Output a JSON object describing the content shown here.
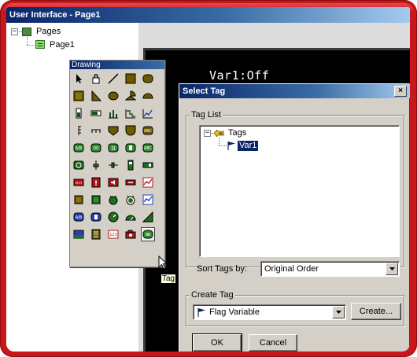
{
  "window": {
    "title": "User Interface - Page1"
  },
  "tree": {
    "root_label": "Pages",
    "child_label": "Page1"
  },
  "screen": {
    "text": "Var1:Off"
  },
  "palette": {
    "title": "Drawing",
    "tooltip": "Tag"
  },
  "dialog": {
    "title": "Select Tag",
    "close_glyph": "×",
    "tag_list": {
      "legend": "Tag List",
      "root_label": "Tags",
      "selected_item": "Var1"
    },
    "sort": {
      "label": "Sort Tags by:",
      "value": "Original Order"
    },
    "create_tag": {
      "legend": "Create Tag",
      "type_value": "Flag Variable",
      "create_button": "Create..."
    },
    "ok_button": "OK",
    "cancel_button": "Cancel"
  },
  "colors": {
    "frame": "#c8161b",
    "titlebar_start": "#0a246a",
    "dialog_face": "#d4d0c8",
    "selection": "#0a246a"
  }
}
